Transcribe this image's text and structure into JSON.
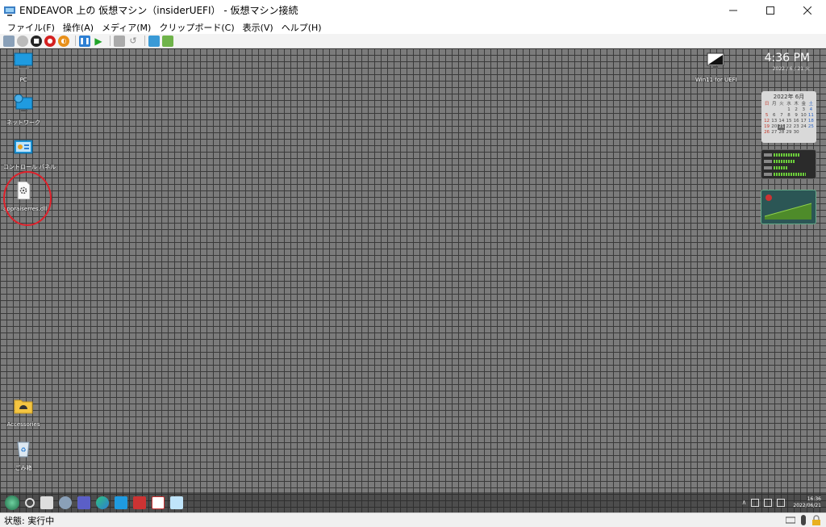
{
  "window": {
    "title": "ENDEAVOR 上の 仮想マシン（insiderUEFI） - 仮想マシン接続"
  },
  "menu": {
    "items": [
      "ファイル(F)",
      "操作(A)",
      "メディア(M)",
      "クリップボード(C)",
      "表示(V)",
      "ヘルプ(H)"
    ]
  },
  "desktop": {
    "icons": [
      {
        "label": "PC",
        "icon": "pc-icon"
      },
      {
        "label": "ネットワーク",
        "icon": "network-icon"
      },
      {
        "label": "コントロール パネル",
        "icon": "control-panel-icon"
      },
      {
        "label": "appraiserres.dll",
        "icon": "dll-file-icon"
      },
      {
        "label": "Accessories",
        "icon": "folder-icon"
      },
      {
        "label": "ごみ箱",
        "icon": "recycle-bin-icon"
      }
    ],
    "top_right_icon_label": "Win11 for UEFI",
    "gadget_clock": {
      "time": "4:36 PM",
      "date": "2022 / 6 / 21  火"
    },
    "calendar": {
      "title": "2022年 6月",
      "weekdays": [
        "日",
        "月",
        "火",
        "水",
        "木",
        "金",
        "土"
      ],
      "days": [
        "",
        "",
        "",
        "1",
        "2",
        "3",
        "4",
        "5",
        "6",
        "7",
        "8",
        "9",
        "10",
        "11",
        "12",
        "13",
        "14",
        "15",
        "16",
        "17",
        "18",
        "19",
        "20",
        "21",
        "22",
        "23",
        "24",
        "25",
        "26",
        "27",
        "28",
        "29",
        "30",
        "",
        ""
      ],
      "today": "21"
    }
  },
  "taskbar": {
    "clock_time": "16:36",
    "clock_date": "2022/06/21"
  },
  "status": {
    "text": "状態: 実行中"
  },
  "colors": {
    "highlight_circle": "#e0202a",
    "desktop_bg": "#7b7b7b"
  }
}
